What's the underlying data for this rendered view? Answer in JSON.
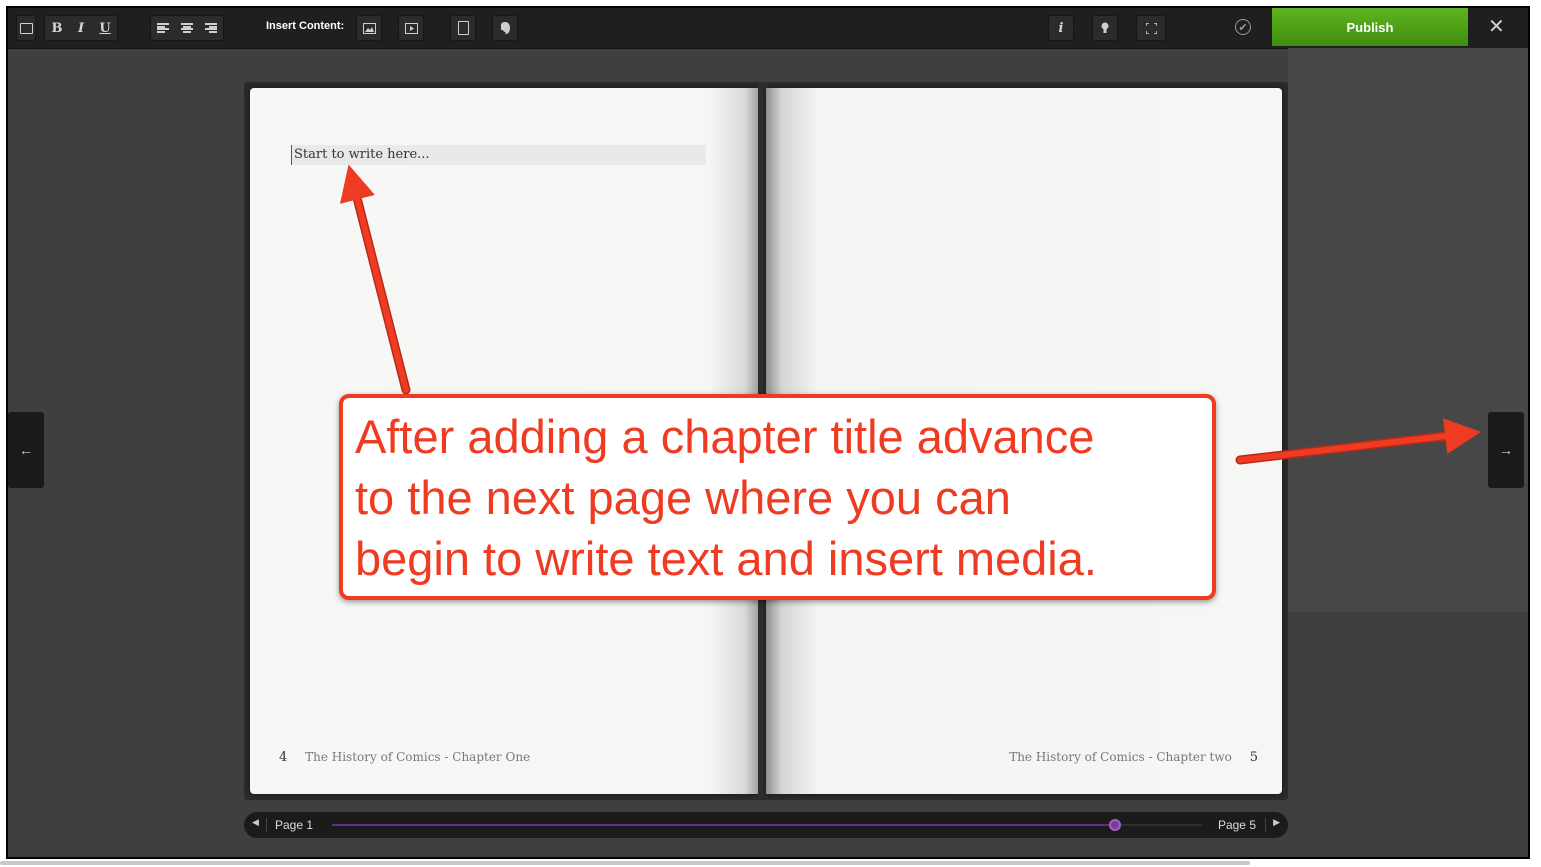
{
  "toolbar": {
    "insert_label": "Insert Content:",
    "bold": "B",
    "italic": "I",
    "underline": "U",
    "info": "i",
    "publish": "Publish",
    "close": "✕",
    "check": "✔",
    "icons": [
      "collapse-icon",
      "bold-icon",
      "italic-icon",
      "underline-icon",
      "align-left-icon",
      "align-center-icon",
      "align-right-icon",
      "image-icon",
      "video-icon",
      "document-icon",
      "evernote-icon",
      "info-icon",
      "lightbulb-icon",
      "fullscreen-icon",
      "check-circle-icon",
      "close-icon"
    ]
  },
  "editor": {
    "placeholder": "Start to write here...",
    "left_page": {
      "number": "4",
      "footer": "The History of Comics - Chapter One"
    },
    "right_page": {
      "number": "5",
      "footer": "The History of Comics - Chapter two"
    }
  },
  "navigation": {
    "prev": "←",
    "next": "→"
  },
  "slider": {
    "start_label": "Page 1",
    "end_label": "Page 5",
    "position_fraction": 0.9
  },
  "annotation": {
    "line1": "After adding a chapter title advance",
    "line2": "to the next page where you can",
    "line3": "begin to write text and insert media.",
    "color": "#ef3b22"
  },
  "colors": {
    "publish_green": "#4aa116",
    "slider_purple": "#7a3a98"
  }
}
